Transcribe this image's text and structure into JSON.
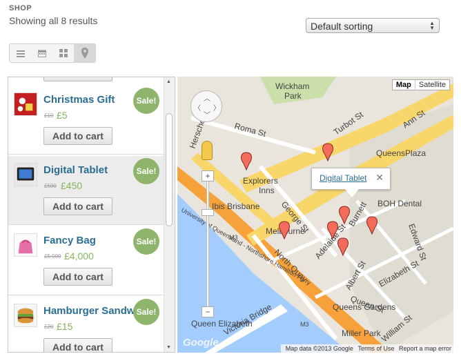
{
  "header": {
    "shop_label": "SHOP",
    "results_text": "Showing all 8 results"
  },
  "sorting": {
    "selected": "Default sorting"
  },
  "view_modes": [
    {
      "icon": "list-icon"
    },
    {
      "icon": "calendar-icon"
    },
    {
      "icon": "grid-icon"
    },
    {
      "icon": "map-pin-icon"
    }
  ],
  "products": [
    {
      "name": "Christmas Gift",
      "old_price": "£10",
      "price": "£5",
      "sale_badge": "Sale!",
      "button": "Add to cart"
    },
    {
      "name": "Digital Tablet",
      "old_price": "£500",
      "price": "£450",
      "sale_badge": "Sale!",
      "button": "Add to cart"
    },
    {
      "name": "Fancy Bag",
      "old_price": "£5,000",
      "price": "£4,000",
      "sale_badge": "Sale!",
      "button": "Add to cart"
    },
    {
      "name": "Hamburger Sandwi",
      "old_price": "£20",
      "price": "£15",
      "sale_badge": "Sale!",
      "button": "Add to cart"
    }
  ],
  "map": {
    "type_map": "Map",
    "type_satellite": "Satellite",
    "infowindow_link": "Digital Tablet",
    "labels": {
      "wickham": "Wickham",
      "park": "Park",
      "turbot": "Turbot St",
      "ann": "Ann St",
      "roma": "Roma St",
      "herschel": "Herschel St",
      "queensplaza": "QueensPlaza",
      "explorers": "Explorers",
      "inns": "Inns",
      "ibis": "Ibis Brisbane",
      "george": "George St",
      "adelaide": "Adelaide St",
      "bohdental": "BOH Dental",
      "melbourne": "Melbourne",
      "burnett": "Burnett",
      "albert": "Albert St",
      "queen": "Queen St",
      "edward": "Edward St",
      "elizabeth": "Elizabeth St",
      "northquay": "North Quay",
      "m3a": "M3",
      "m3b": "M3",
      "uq": "University of Queensland - Northshore Hamilton Ferry",
      "victoria": "Victoria Bridge",
      "queensgardens": "Queens Gardens",
      "qeliz": "Queen Elizabeth",
      "miller": "Miller Park",
      "william": "William St"
    },
    "attribution": {
      "data": "Map data ©2013 Google",
      "terms": "Terms of Use",
      "report": "Report a map error"
    },
    "watermark": "Google"
  }
}
